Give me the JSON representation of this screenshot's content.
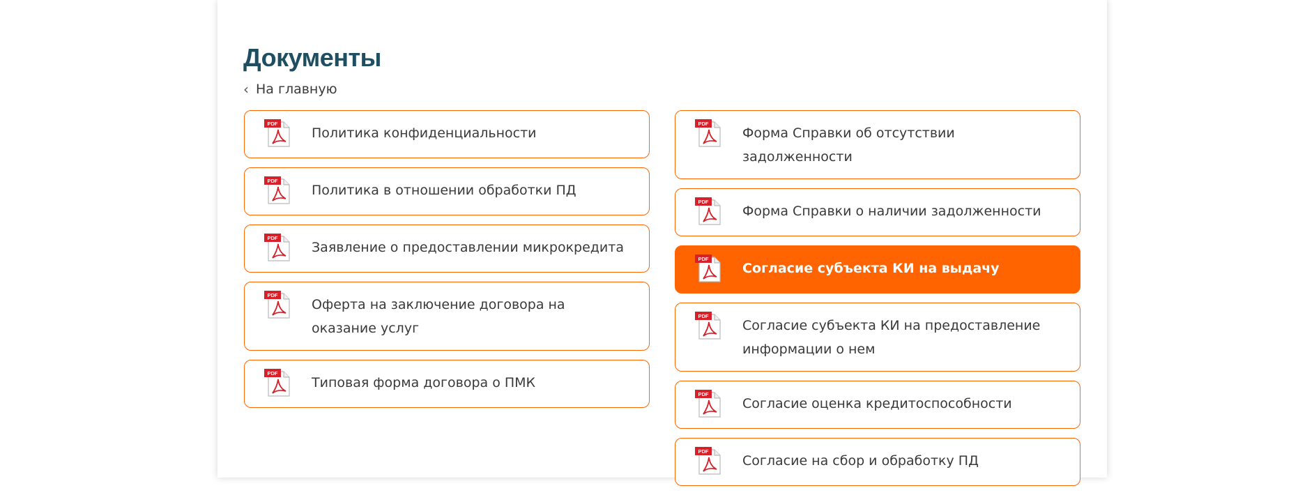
{
  "page": {
    "title": "Документы",
    "back_link": "На главную"
  },
  "colors": {
    "accent": "#ff6600",
    "title": "#1f4e61",
    "pdf_red": "#d6202a"
  },
  "icons": {
    "document": "pdf-file-icon",
    "back": "chevron-left-icon"
  },
  "pdf_badge": "PDF",
  "documents_left": [
    {
      "label": "Политика конфиденциальности"
    },
    {
      "label": "Политика в отношении обработки ПД"
    },
    {
      "label": "Заявление о предоставлении микрокредита"
    },
    {
      "label": "Оферта на заключение договора на оказание услуг"
    },
    {
      "label": "Типовая форма договора о ПМК"
    }
  ],
  "documents_right": [
    {
      "label": "Форма Справки об отсутствии задолженности"
    },
    {
      "label": "Форма Справки о наличии задолженности"
    },
    {
      "label": "Согласие субъекта КИ на выдачу",
      "active": true
    },
    {
      "label": "Согласие субъекта КИ на предоставление информации о нем"
    },
    {
      "label": "Согласие оценка кредитоспособности"
    },
    {
      "label": "Согласие на сбор и обработку ПД"
    }
  ]
}
